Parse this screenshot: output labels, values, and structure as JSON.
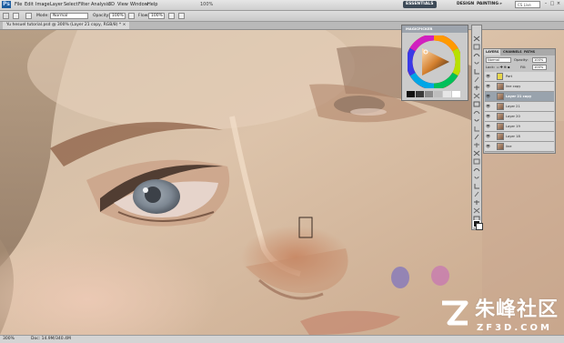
{
  "app": {
    "logo_text": "Ps"
  },
  "menubar": {
    "items": [
      "File",
      "Edit",
      "Image",
      "Layer",
      "Select",
      "Filter",
      "Analysis",
      "3D",
      "View",
      "Window",
      "Help"
    ],
    "zoom": "100%",
    "workspaces": [
      "ESSENTIALS",
      "DESIGN",
      "PAINTING"
    ],
    "active_workspace": "ESSENTIALS",
    "more": "»",
    "search_placeholder": "CS Live",
    "window_controls": [
      "–",
      "□",
      "×"
    ]
  },
  "options": {
    "mode_label": "Mode:",
    "mode_value": "Normal",
    "opacity_label": "Opacity:",
    "opacity_value": "100%",
    "flow_label": "Flow:",
    "flow_value": "100%"
  },
  "document": {
    "tab_title": "Yu hesuel tutorial.psd @ 300% (Layer 21 copy, RGB/8) * ×"
  },
  "statusbar": {
    "zoom": "300%",
    "doc_info": "Doc: 14.9M/340.4M"
  },
  "color_wheel": {
    "title": "MAGICPICKER",
    "swatches": [
      "#111111",
      "#3a3a3a",
      "#8a8a8a",
      "#bdbdbd",
      "#e6e6e6",
      "#ffffff"
    ]
  },
  "tools": {
    "icons": [
      "move-icon",
      "marquee-icon",
      "lasso-icon",
      "quick-select-icon",
      "crop-icon",
      "eyedropper-icon",
      "healing-icon",
      "brush-icon",
      "clone-stamp-icon",
      "history-brush-icon",
      "eraser-icon",
      "gradient-icon",
      "blur-icon",
      "dodge-icon",
      "pen-icon",
      "type-icon",
      "path-select-icon",
      "shape-icon",
      "3d-rotate-icon",
      "3d-orbit-icon",
      "hand-icon",
      "zoom-icon",
      "colors-icon",
      "quickmask-icon"
    ]
  },
  "layers_panel": {
    "tabs": [
      "LAYERS",
      "CHANNELS",
      "PATHS"
    ],
    "active_tab": "LAYERS",
    "blend_mode": "Normal",
    "opacity_label": "Opacity:",
    "opacity_value": "100%",
    "lock_label": "Lock:",
    "fill_label": "Fill:",
    "fill_value": "100%",
    "layers": [
      {
        "name": "Part",
        "selected": false
      },
      {
        "name": "line copy",
        "selected": false
      },
      {
        "name": "Layer 21 copy",
        "selected": true
      },
      {
        "name": "Layer 21",
        "selected": false
      },
      {
        "name": "Layer 20",
        "selected": false
      },
      {
        "name": "Layer 19",
        "selected": false
      },
      {
        "name": "Layer 18",
        "selected": false
      },
      {
        "name": "line",
        "selected": false
      }
    ]
  },
  "watermark": {
    "title": "朱峰社区",
    "domain": "ZF3D.COM"
  },
  "colors": {
    "accent": "#3d4a57",
    "skin": "#d9b79c",
    "iris": "#7e8893"
  }
}
